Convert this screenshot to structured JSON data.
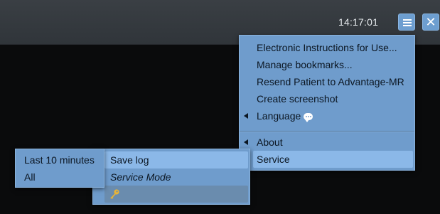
{
  "topbar": {
    "time": "14:17:01",
    "menu_icon": "hamburger-icon",
    "close_icon": "close-icon",
    "close_glyph": "✕"
  },
  "main_menu": {
    "items": [
      {
        "label": "Electronic Instructions for Use...",
        "submenu": false
      },
      {
        "label": "Manage bookmarks...",
        "submenu": false
      },
      {
        "label": "Resend Patient to Advantage-MR",
        "submenu": false
      },
      {
        "label": "Create screenshot",
        "submenu": false
      },
      {
        "label": "Language",
        "submenu": true,
        "icon": "speech-bubble-icon"
      },
      {
        "label": "About",
        "submenu": true
      },
      {
        "label": "Service",
        "submenu": false,
        "highlighted": true
      }
    ]
  },
  "service_menu": {
    "items": [
      {
        "label": "Save log",
        "highlighted": true
      },
      {
        "label": "Service Mode",
        "style": "italic"
      },
      {
        "label": "",
        "icon": "key-icon"
      }
    ]
  },
  "log_menu": {
    "items": [
      {
        "label": "Last 10 minutes"
      },
      {
        "label": "All"
      }
    ]
  },
  "colors": {
    "menu_bg": "#6f9ccc",
    "menu_highlight": "#8bb8e8",
    "topbar_bg": "#33383d",
    "background": "#0a0b0c",
    "button_bg": "#6d9ed0",
    "key_gold": "#e8b437"
  }
}
